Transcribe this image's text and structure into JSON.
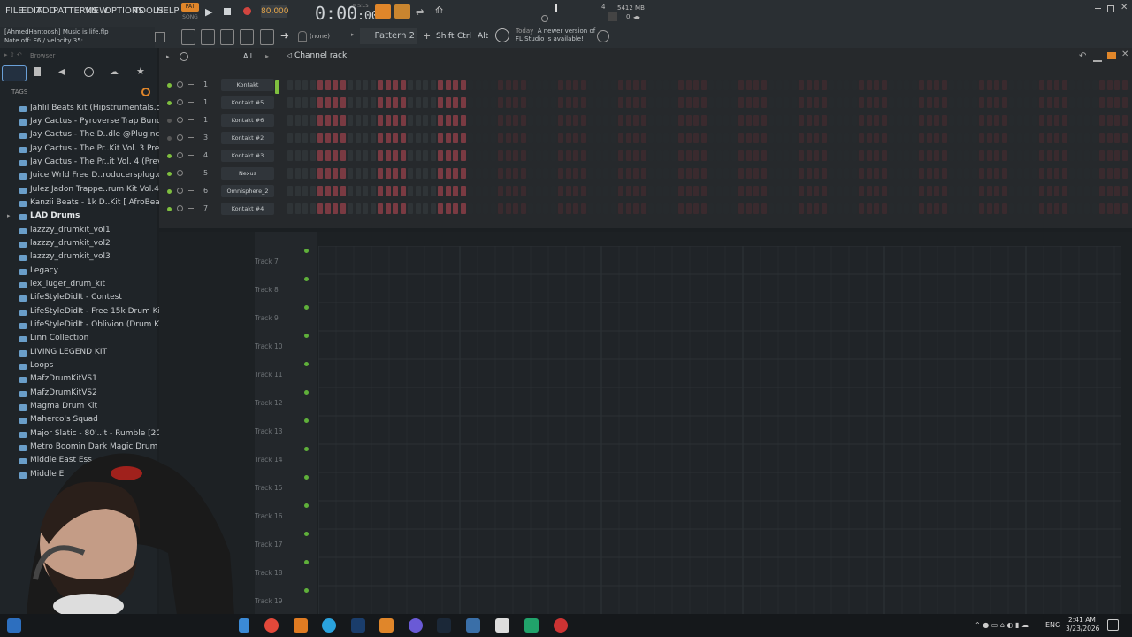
{
  "menubar": {
    "items": [
      "FILE",
      "EDIT",
      "ADD",
      "PATTERNS",
      "VIEW",
      "OPTIONS",
      "TOOLS",
      "HELP"
    ],
    "tempo": "80.000",
    "time": "0:00",
    "time_ms": ":00",
    "time_unit": "M:S:CS",
    "memory": "5412 MB",
    "cpu_count": "4",
    "voices": "0",
    "pat_label": "PAT",
    "song_label": "SONG"
  },
  "info": {
    "project": "[AhmedHantoosh] Music is life.flp",
    "hint": "Note off: E6 / velocity 35:"
  },
  "toolbar2": {
    "none_label": "(none)",
    "pattern": "Pattern 2",
    "shift": "Shift",
    "ctrl": "Ctrl",
    "alt": "Alt",
    "news_title": "Today",
    "news_line1": "A newer version of",
    "news_line2": "FL Studio is available!"
  },
  "browser": {
    "title": "Browser",
    "tags_label": "TAGS",
    "items": [
      "Jahlil Beats Kit (Hipstrumentals.com)",
      "Jay Cactus - Pyroverse Trap Bundle",
      "Jay Cactus - The D..dle @Pluginclouds",
      "Jay Cactus - The Pr..Kit Vol. 3 Preview",
      "Jay Cactus - The Pr..it Vol. 4 (Preview)",
      "Juice Wrld Free D..roducersplug.com]",
      "Julez Jadon Trappe..rum Kit Vol.4 WAV",
      "Kanzii Beats - 1k D..Kit [ AfroBeats ]",
      "LAD Drums",
      "lazzzy_drumkit_vol1",
      "lazzzy_drumkit_vol2",
      "lazzzy_drumkit_vol3",
      "Legacy",
      "lex_luger_drum_kit",
      "LifeStyleDidIt - Contest",
      "LifeStyleDidIt - Free 15k Drum Kit",
      "LifeStyleDidIt - Oblivion (Drum Kit)",
      "Linn Collection",
      "LIVING LEGEND KIT",
      "Loops",
      "MafzDrumKitVS1",
      "MafzDrumKitVS2",
      "Magma Drum Kit",
      "Maherco's Squad",
      "Major Slatic - 80'..it - Rumble [2021]",
      "Metro Boomin Dark Magic Drum Kit",
      "Middle East Ess",
      "Middle E"
    ]
  },
  "channel_rack": {
    "filter": "All",
    "title": "Channel rack",
    "channels": [
      {
        "num": "1",
        "name": "Kontakt"
      },
      {
        "num": "1",
        "name": "Kontakt #5"
      },
      {
        "num": "1",
        "name": "Kontakt #6"
      },
      {
        "num": "3",
        "name": "Kontakt #2"
      },
      {
        "num": "4",
        "name": "Kontakt #3"
      },
      {
        "num": "5",
        "name": "Nexus"
      },
      {
        "num": "6",
        "name": "Omnisphere_2"
      },
      {
        "num": "7",
        "name": "Kontakt #4"
      }
    ]
  },
  "playlist": {
    "tracks": [
      "Track 7",
      "Track 8",
      "Track 9",
      "Track 10",
      "Track 11",
      "Track 12",
      "Track 13",
      "Track 14",
      "Track 15",
      "Track 16",
      "Track 17",
      "Track 18",
      "Track 19"
    ]
  },
  "taskbar": {
    "lang": "ENG",
    "time": "2:41 AM",
    "date": "3/23/2026"
  },
  "colors": {
    "accent_orange": "#e0862a",
    "step_red": "#7a3a42",
    "step_dark": "#2f3437",
    "led_green": "#7fbf3f"
  }
}
